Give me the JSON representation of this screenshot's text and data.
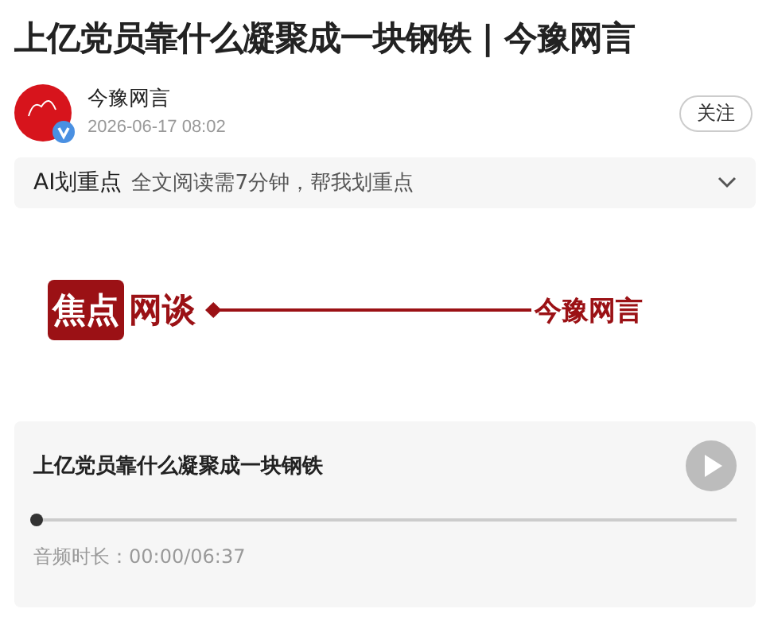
{
  "article": {
    "title": "上亿党员靠什么凝聚成一块钢铁 | 今豫网言"
  },
  "author": {
    "name": "今豫网言",
    "time": "2026-06-17 08:02",
    "verified": true,
    "follow_label": "关注"
  },
  "ai_summary": {
    "label": "AI划重点",
    "text": "全文阅读需7分钟，帮我划重点"
  },
  "banner": {
    "badge": "焦点",
    "word": "网谈",
    "brand": "今豫网言"
  },
  "audio": {
    "title": "上亿党员靠什么凝聚成一块钢铁",
    "level": 0,
    "duration_label": "音频时长：00:00/06:37"
  }
}
